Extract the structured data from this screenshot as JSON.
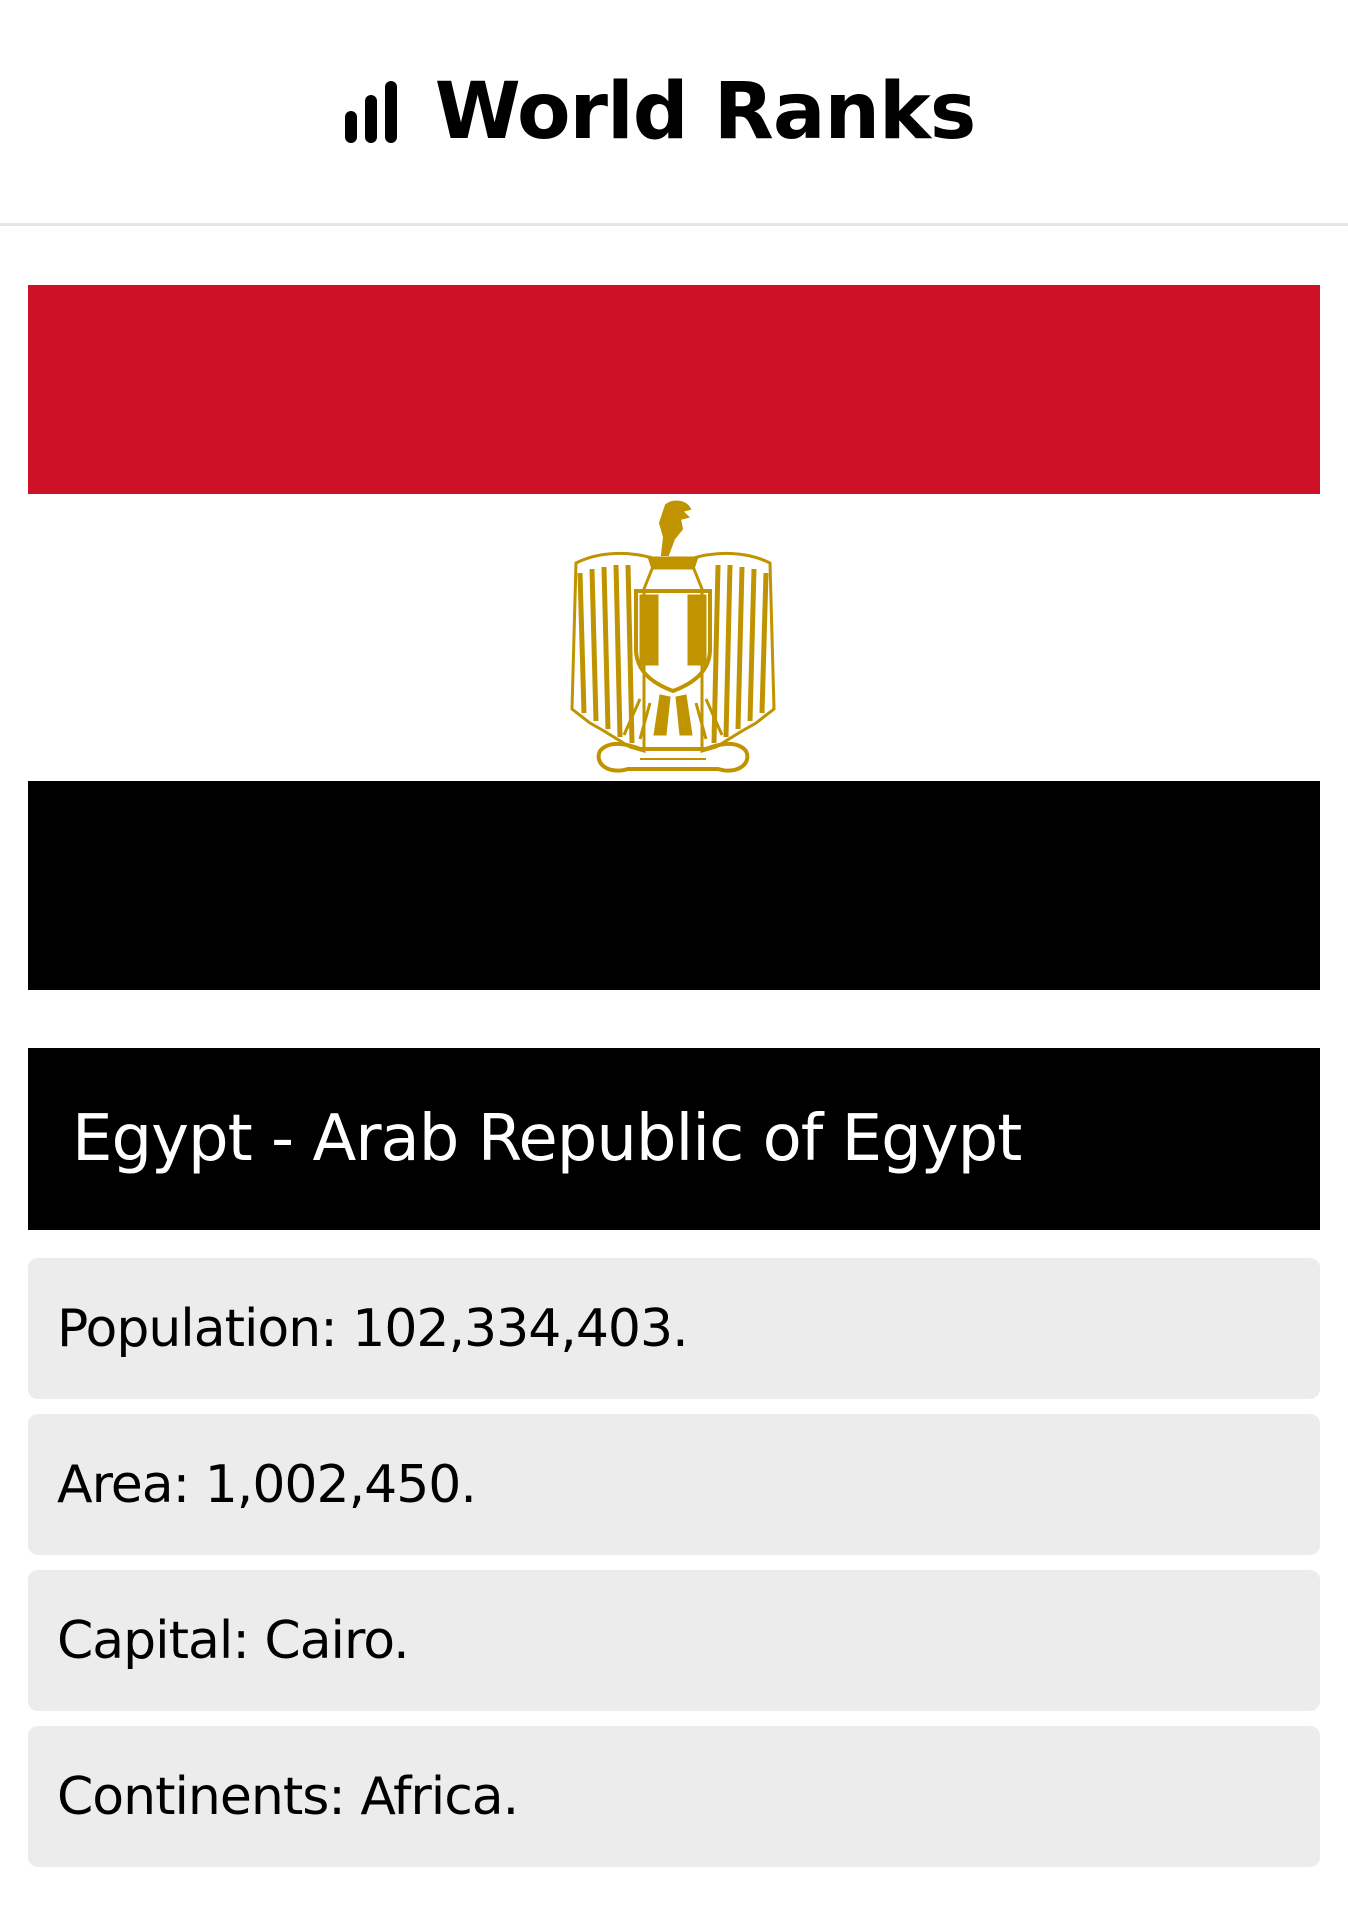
{
  "header": {
    "icon": "bar-chart-icon",
    "title": "World Ranks"
  },
  "flag": {
    "colors": {
      "red": "#ce1126",
      "white": "#ffffff",
      "black": "#000000",
      "gold": "#c09300"
    },
    "emblem": "eagle-of-saladin-icon"
  },
  "country": {
    "title": "Egypt - Arab Republic of Egypt"
  },
  "info": [
    {
      "text": "Population: 102,334,403."
    },
    {
      "text": "Area: 1,002,450."
    },
    {
      "text": "Capital: Cairo."
    },
    {
      "text": "Continents: Africa."
    }
  ]
}
